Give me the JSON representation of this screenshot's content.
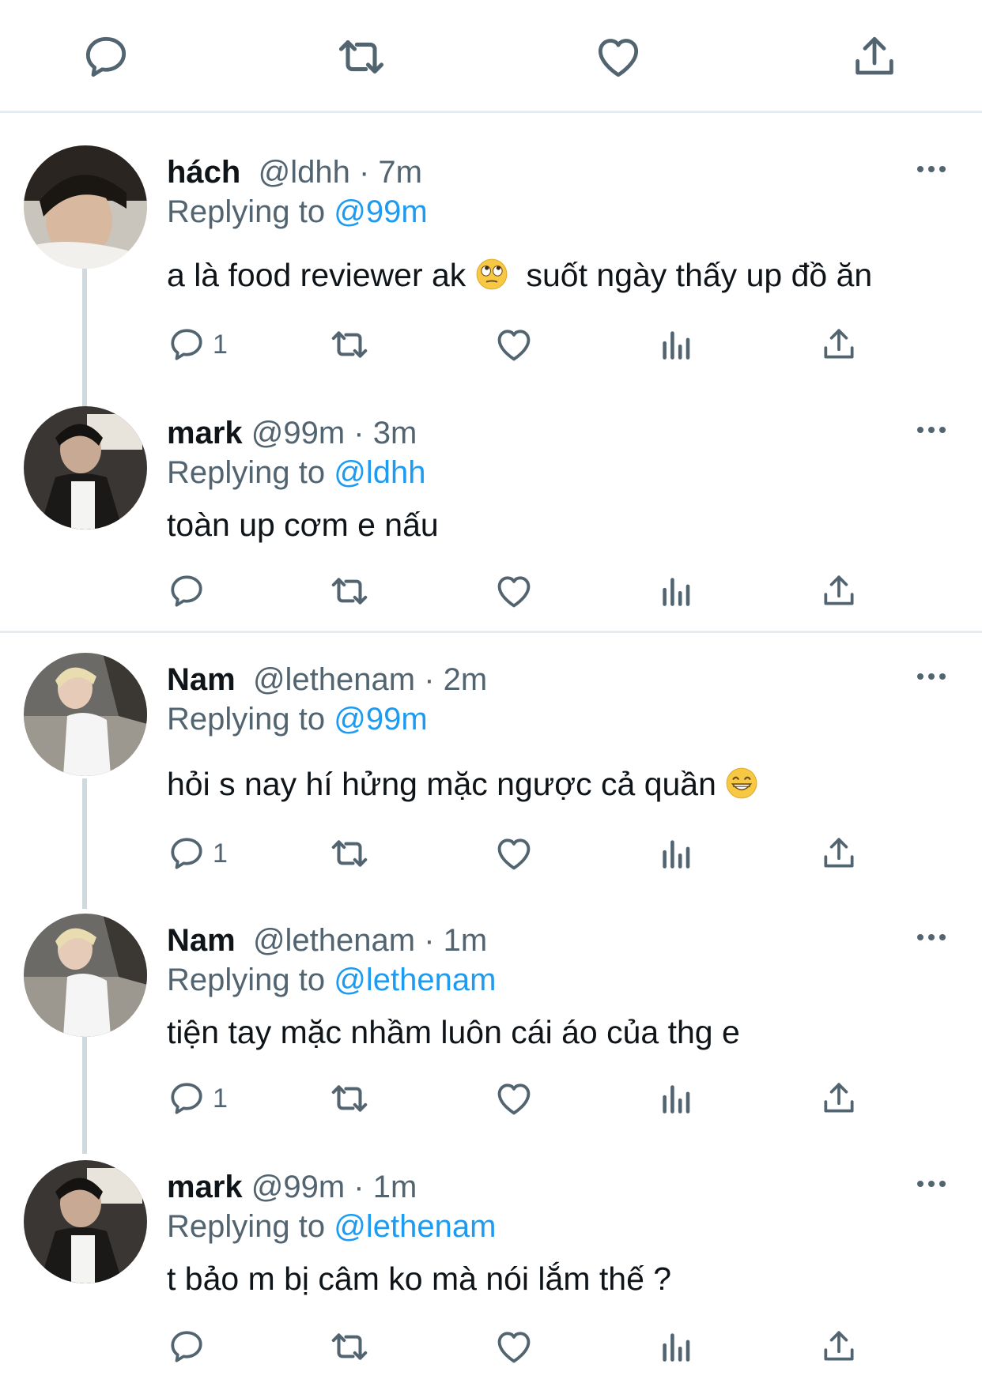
{
  "top_actions": [
    "reply-icon",
    "retweet-icon",
    "like-icon",
    "share-icon"
  ],
  "colors": {
    "link": "#1d9bf0",
    "muted": "#536471",
    "text": "#0f1419",
    "divider": "#e6ecf0"
  },
  "tweets": [
    {
      "name": "hách",
      "handle": "@ldhh",
      "time": "· 7m",
      "replying_prefix": "Replying to",
      "replying_to": "@99m",
      "text_before": "a là food reviewer ak",
      "emoji": "face-with-rolling-eyes",
      "text_after": "  suốt ngày thấy up đồ ăn",
      "reply_count": "1"
    },
    {
      "name": "mark",
      "handle": "@99m",
      "time": "· 3m",
      "replying_prefix": "Replying to",
      "replying_to": "@ldhh",
      "text": "toàn up cơm e nấu",
      "reply_count": ""
    },
    {
      "name": "Nam",
      "handle": "@lethenam",
      "time": "· 2m",
      "replying_prefix": "Replying to",
      "replying_to": "@99m",
      "text_before": "hỏi s nay hí hửng mặc ngược cả quần",
      "emoji": "grinning-face-with-smiling-eyes",
      "reply_count": "1"
    },
    {
      "name": "Nam",
      "handle": "@lethenam",
      "time": "· 1m",
      "replying_prefix": "Replying to",
      "replying_to": "@lethenam",
      "text": "tiện tay mặc nhầm luôn cái áo của thg e",
      "reply_count": "1"
    },
    {
      "name": "mark",
      "handle": "@99m",
      "time": "· 1m",
      "replying_prefix": "Replying to",
      "replying_to": "@lethenam",
      "text": "t bảo m bị câm ko mà nói lắm thế ?",
      "reply_count": ""
    }
  ]
}
